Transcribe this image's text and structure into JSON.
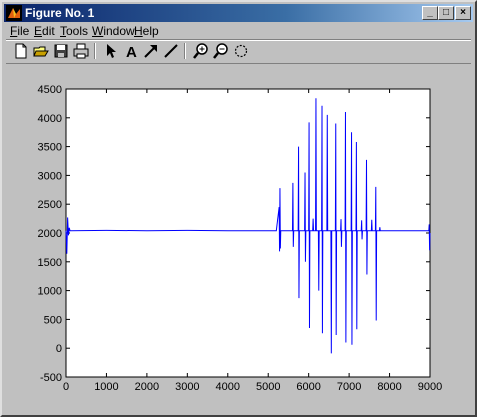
{
  "window": {
    "title": "Figure No. 1",
    "controls": {
      "minimize": "_",
      "maximize": "□",
      "close": "×"
    }
  },
  "menu": [
    {
      "key": "F",
      "rest": "ile"
    },
    {
      "key": "E",
      "rest": "dit"
    },
    {
      "key": "T",
      "rest": "ools"
    },
    {
      "key": "W",
      "rest": "indow"
    },
    {
      "key": "H",
      "rest": "elp"
    }
  ],
  "toolbar": {
    "icons": [
      "new-file-icon",
      "open-folder-icon",
      "save-icon",
      "print-icon",
      "select-arrow-icon",
      "text-icon",
      "arrow-icon",
      "line-icon",
      "zoom-in-icon",
      "zoom-out-icon",
      "rotate-icon"
    ],
    "text_tool_glyph": "A"
  },
  "colors": {
    "title_bar": "#0a246a",
    "plot_line": "#0000ff",
    "figure_bg": "#c0c0c0",
    "axes_bg": "#ffffff"
  },
  "chart_data": {
    "type": "line",
    "title": "",
    "xlabel": "",
    "ylabel": "",
    "xlim": [
      0,
      9000
    ],
    "ylim": [
      -500,
      4500
    ],
    "xticks": [
      0,
      1000,
      2000,
      3000,
      4000,
      5000,
      6000,
      7000,
      8000,
      9000
    ],
    "yticks": [
      -500,
      0,
      500,
      1000,
      1500,
      2000,
      2500,
      3000,
      3500,
      4000,
      4500
    ],
    "grid": false,
    "series": [
      {
        "color": "#0000ff",
        "baseline": 2040,
        "points": [
          [
            0,
            2040
          ],
          [
            20,
            1640
          ],
          [
            40,
            2270
          ],
          [
            60,
            1960
          ],
          [
            80,
            2090
          ],
          [
            100,
            2040
          ],
          [
            1000,
            2045
          ],
          [
            2000,
            2040
          ],
          [
            3000,
            2045
          ],
          [
            4000,
            2040
          ],
          [
            5200,
            2040
          ],
          [
            5270,
            2450
          ],
          [
            5280,
            1680
          ],
          [
            5290,
            2780
          ],
          [
            5300,
            1730
          ],
          [
            5310,
            2040
          ],
          [
            5600,
            2040
          ],
          [
            5610,
            2870
          ],
          [
            5620,
            1760
          ],
          [
            5630,
            2040
          ],
          [
            5740,
            2040
          ],
          [
            5750,
            3500
          ],
          [
            5760,
            870
          ],
          [
            5770,
            2040
          ],
          [
            5900,
            2040
          ],
          [
            5910,
            3050
          ],
          [
            5920,
            1500
          ],
          [
            5930,
            2040
          ],
          [
            6000,
            2040
          ],
          [
            6010,
            3920
          ],
          [
            6020,
            350
          ],
          [
            6030,
            2040
          ],
          [
            6100,
            2040
          ],
          [
            6110,
            2250
          ],
          [
            6120,
            2040
          ],
          [
            6170,
            2040
          ],
          [
            6180,
            4340
          ],
          [
            6190,
            2040
          ],
          [
            6240,
            2040
          ],
          [
            6250,
            1000
          ],
          [
            6260,
            2040
          ],
          [
            6320,
            2040
          ],
          [
            6330,
            4210
          ],
          [
            6340,
            260
          ],
          [
            6350,
            2040
          ],
          [
            6450,
            2040
          ],
          [
            6460,
            4050
          ],
          [
            6470,
            2040
          ],
          [
            6550,
            2040
          ],
          [
            6560,
            -90
          ],
          [
            6570,
            2040
          ],
          [
            6660,
            2040
          ],
          [
            6670,
            3900
          ],
          [
            6680,
            230
          ],
          [
            6690,
            2040
          ],
          [
            6790,
            2040
          ],
          [
            6800,
            2240
          ],
          [
            6810,
            1760
          ],
          [
            6820,
            2040
          ],
          [
            6900,
            2040
          ],
          [
            6910,
            4100
          ],
          [
            6920,
            100
          ],
          [
            6930,
            2040
          ],
          [
            7050,
            2040
          ],
          [
            7060,
            3750
          ],
          [
            7070,
            60
          ],
          [
            7080,
            2040
          ],
          [
            7170,
            2040
          ],
          [
            7180,
            3580
          ],
          [
            7190,
            330
          ],
          [
            7200,
            2040
          ],
          [
            7300,
            2040
          ],
          [
            7310,
            2220
          ],
          [
            7320,
            1890
          ],
          [
            7330,
            2040
          ],
          [
            7420,
            2040
          ],
          [
            7430,
            3270
          ],
          [
            7440,
            1280
          ],
          [
            7450,
            2040
          ],
          [
            7550,
            2040
          ],
          [
            7560,
            2230
          ],
          [
            7570,
            2040
          ],
          [
            7650,
            2040
          ],
          [
            7660,
            2800
          ],
          [
            7670,
            480
          ],
          [
            7680,
            2040
          ],
          [
            7750,
            2040
          ],
          [
            7760,
            2100
          ],
          [
            7770,
            2040
          ],
          [
            8970,
            2040
          ],
          [
            8980,
            2150
          ],
          [
            8990,
            1700
          ],
          [
            9000,
            2000
          ]
        ]
      }
    ]
  }
}
